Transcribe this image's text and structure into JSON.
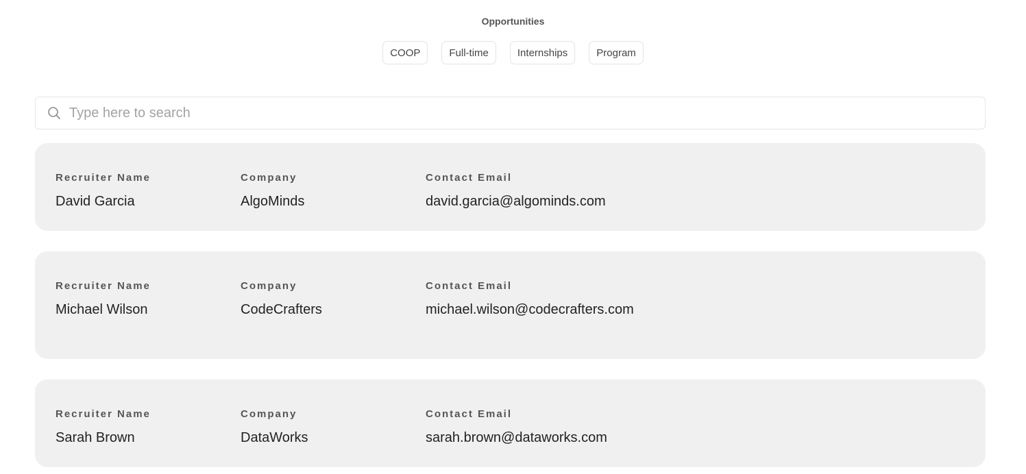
{
  "header": {
    "title": "Opportunities",
    "filters": [
      "COOP",
      "Full-time",
      "Internships",
      "Program"
    ]
  },
  "search": {
    "placeholder": "Type here to search",
    "value": ""
  },
  "labels": {
    "name": "Recruiter Name",
    "company": "Company",
    "email": "Contact Email"
  },
  "recruiters": [
    {
      "name": "David Garcia",
      "company": "AlgoMinds",
      "email": "david.garcia@algominds.com"
    },
    {
      "name": "Michael Wilson",
      "company": "CodeCrafters",
      "email": "michael.wilson@codecrafters.com"
    },
    {
      "name": "Sarah Brown",
      "company": "DataWorks",
      "email": "sarah.brown@dataworks.com"
    }
  ],
  "icons": {
    "search": "search-icon"
  },
  "colors": {
    "card_background": "#f0f0f0",
    "label_text": "#555555",
    "placeholder_text": "#a3a3a3"
  }
}
